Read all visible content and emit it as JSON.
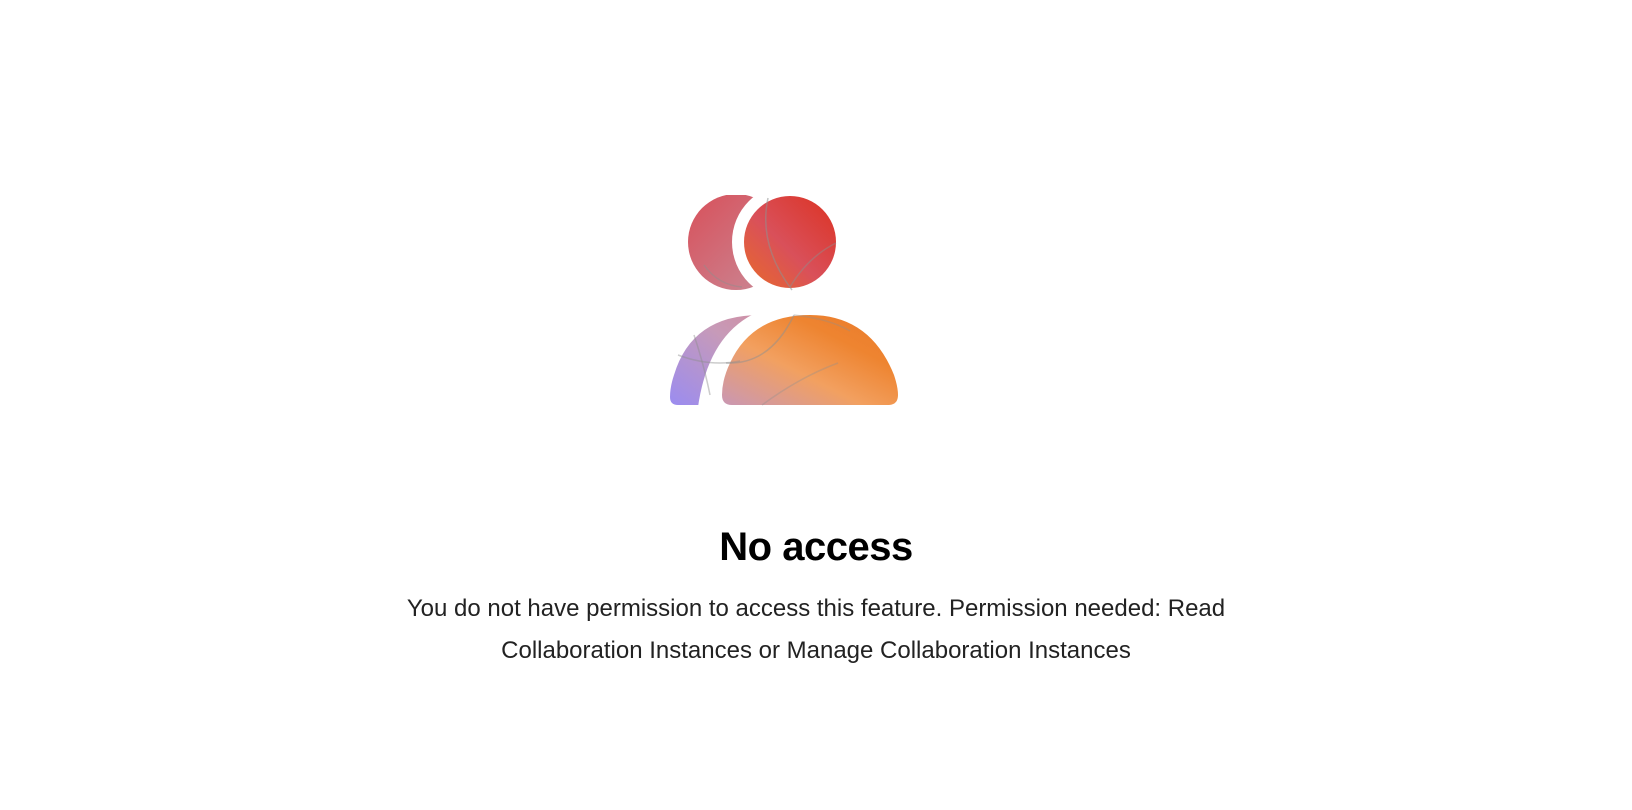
{
  "empty_state": {
    "illustration_icon": "users-no-access-icon",
    "title": "No access",
    "message": "You do not have permission to access this feature. Permission needed: Read Collaboration Instances or Manage Collaboration Instances"
  },
  "colors": {
    "background": "#ffffff",
    "title": "#000000",
    "message": "#222222",
    "gradient_red": "#dc3b2f",
    "gradient_orange": "#ee8430",
    "gradient_violet": "#9b8cf0",
    "gradient_pink": "#d17a88"
  }
}
